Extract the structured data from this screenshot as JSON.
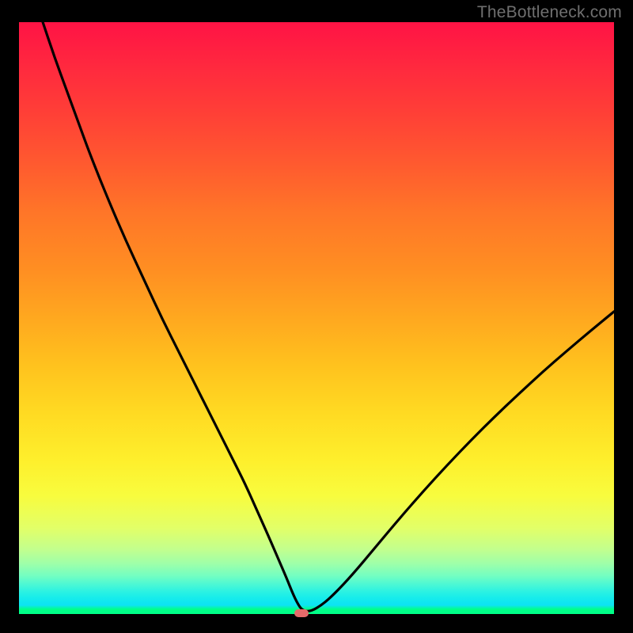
{
  "watermark": "TheBottleneck.com",
  "colors": {
    "background": "#000000",
    "curve_stroke": "#000000",
    "marker_fill": "#e46a6a",
    "watermark_text": "#6f6f6f"
  },
  "plot": {
    "outer_width": 800,
    "outer_height": 800,
    "inset_left": 24,
    "inset_top": 28,
    "inner_width": 752,
    "inner_height": 748
  },
  "chart_data": {
    "type": "line",
    "title": "",
    "xlabel": "",
    "ylabel": "",
    "xlim": [
      0,
      100
    ],
    "ylim": [
      0,
      100
    ],
    "notes": "V-shaped bottleneck curve; both axes unlabeled; background is vertical rainbow gradient (red top → green bottom). Minimum (ideal match) around x≈47 where y≈0.",
    "series": [
      {
        "name": "bottleneck-curve",
        "x": [
          4,
          6,
          8,
          10,
          12,
          15,
          18,
          21,
          24,
          27,
          30,
          33,
          36,
          38,
          40,
          42,
          43.5,
          45,
          46,
          46.8,
          47.6,
          49,
          51,
          53,
          56,
          60,
          64,
          68,
          72,
          76,
          80,
          84,
          88,
          92,
          96,
          100
        ],
        "y": [
          100,
          94,
          88.5,
          83,
          77.5,
          70,
          63,
          56.5,
          50,
          44,
          38,
          32,
          26,
          22,
          17.5,
          13,
          9.5,
          6,
          3.5,
          1.8,
          0.6,
          0.4,
          1.6,
          3.4,
          6.6,
          11.4,
          16.2,
          20.8,
          25.2,
          29.4,
          33.4,
          37.2,
          40.9,
          44.4,
          47.8,
          51.1
        ]
      }
    ],
    "marker": {
      "x": 47.5,
      "y": 0,
      "shape": "pill",
      "color": "#e46a6a"
    },
    "background_gradient_stops": [
      {
        "pct": 0,
        "color": "#ff1345"
      },
      {
        "pct": 25,
        "color": "#ff6a2b"
      },
      {
        "pct": 50,
        "color": "#ffa81f"
      },
      {
        "pct": 75,
        "color": "#feef2c"
      },
      {
        "pct": 90,
        "color": "#9effa9"
      },
      {
        "pct": 100,
        "color": "#00ff88"
      }
    ]
  }
}
